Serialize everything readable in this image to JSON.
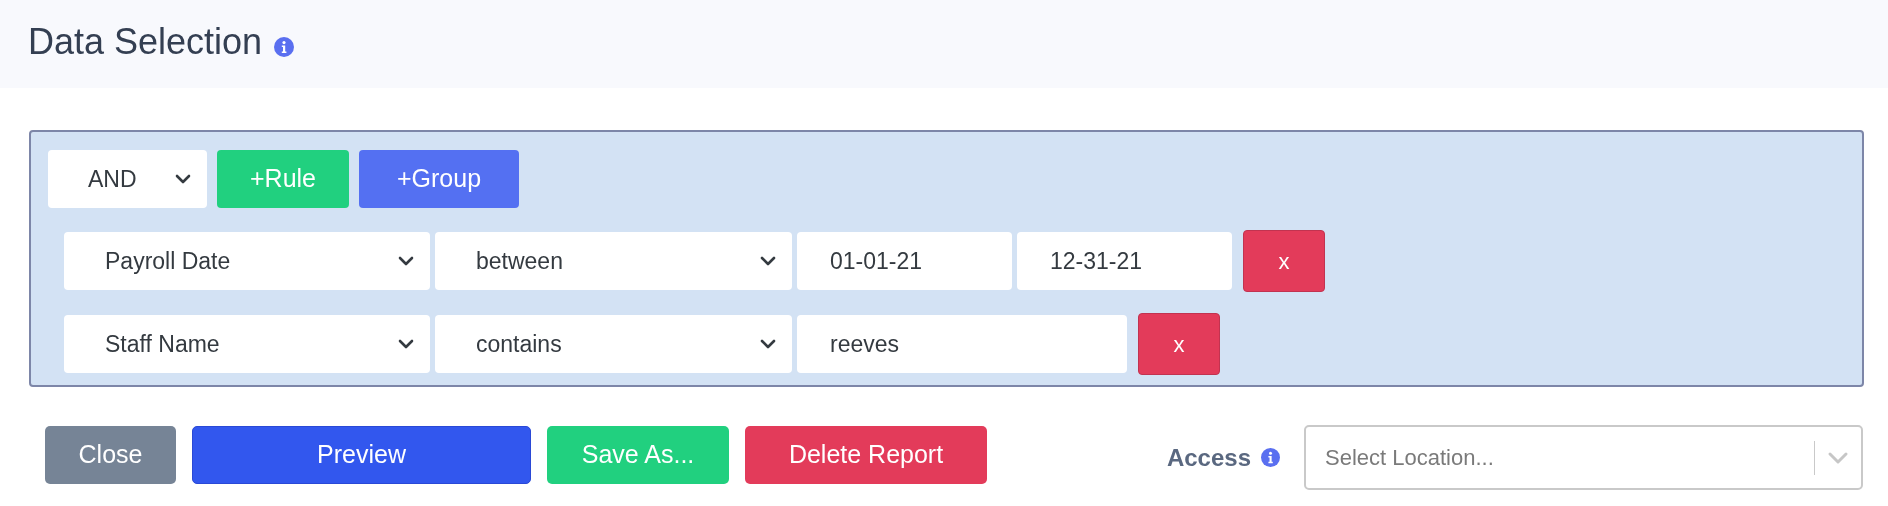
{
  "header": {
    "title": "Data Selection"
  },
  "rule_group": {
    "conjunction": "AND",
    "add_buttons": [
      {
        "label": "+Rule",
        "kind": "rule"
      },
      {
        "label": "+Group",
        "kind": "group"
      }
    ],
    "rules": [
      {
        "field": "Payroll Date",
        "operator": "between",
        "values": [
          "01-01-21",
          "12-31-21"
        ],
        "remove": "x"
      },
      {
        "field": "Staff Name",
        "operator": "contains",
        "values": [
          "reeves"
        ],
        "remove": "x"
      }
    ]
  },
  "actions": [
    {
      "label": "Close",
      "kind": "close"
    },
    {
      "label": "Preview",
      "kind": "preview"
    },
    {
      "label": "Save As...",
      "kind": "save"
    },
    {
      "label": "Delete Report",
      "kind": "delete"
    }
  ],
  "access": {
    "label": "Access",
    "placeholder": "Select Location..."
  }
}
